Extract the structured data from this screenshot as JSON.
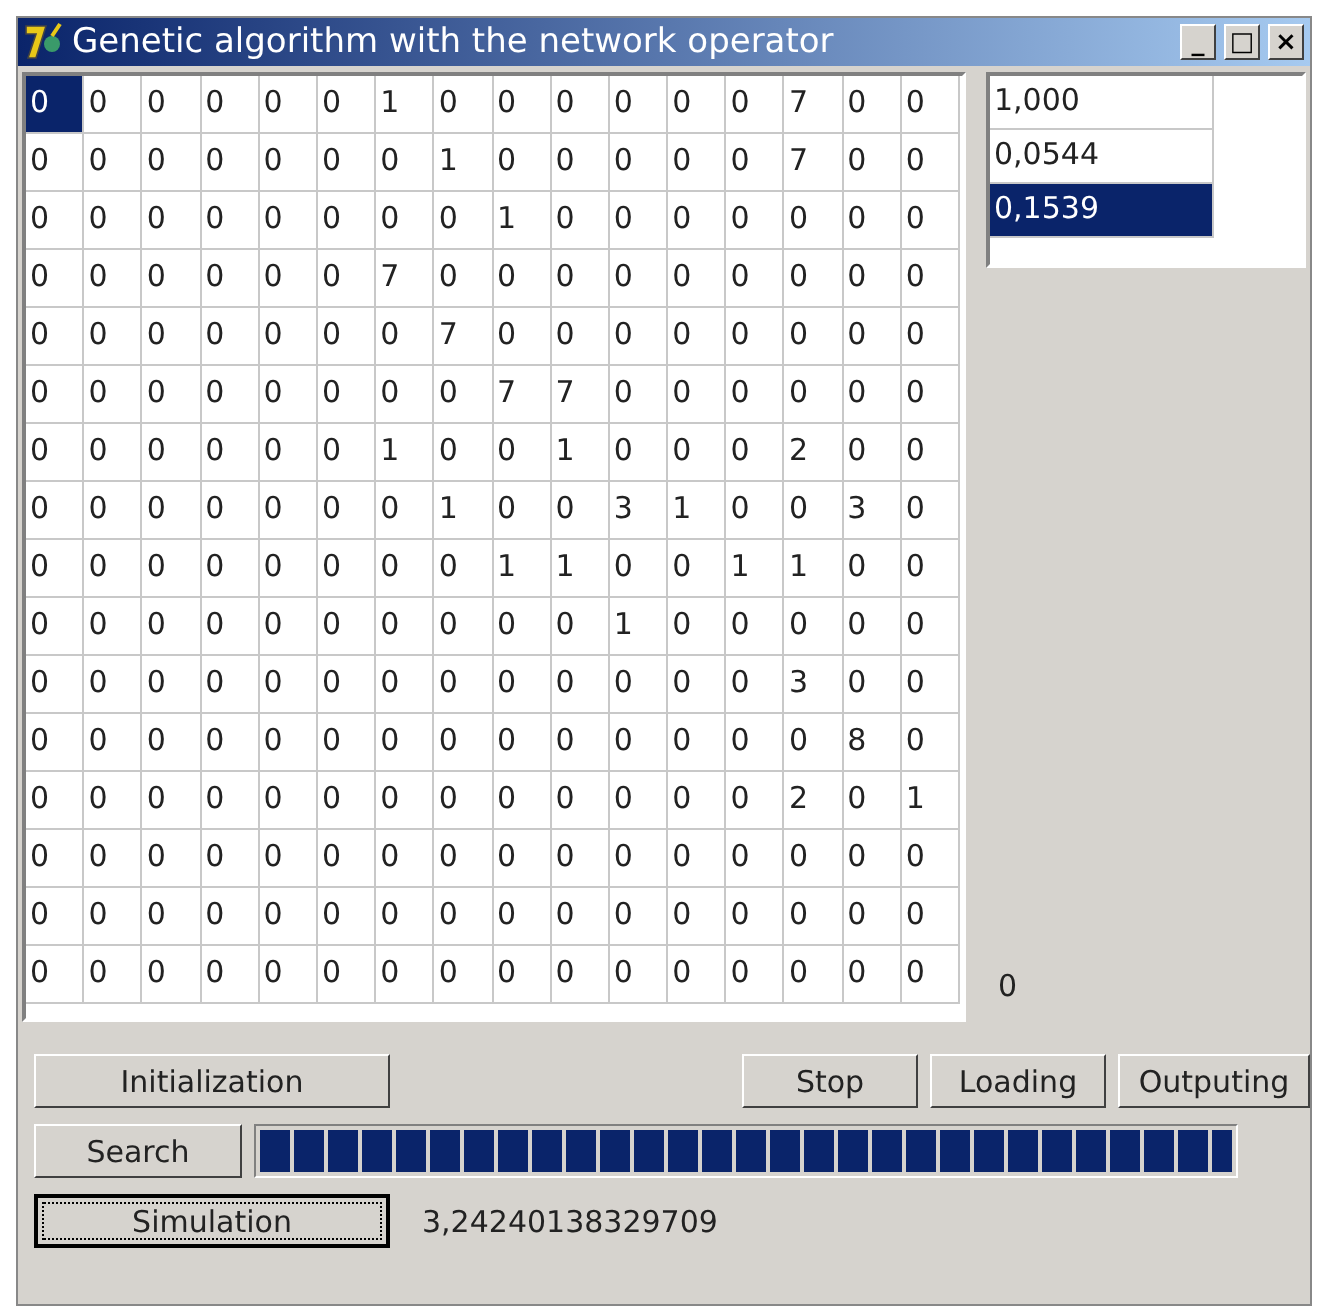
{
  "window": {
    "title": "Genetic algorithm with the network operator",
    "controls": [
      "_",
      "□",
      "×"
    ]
  },
  "matrix": {
    "rows": [
      [
        {
          "text": "0",
          "selected": true
        },
        {
          "text": "0",
          "selected": false
        },
        {
          "text": "0",
          "selected": false
        },
        {
          "text": "0",
          "selected": false
        },
        {
          "text": "0",
          "selected": false
        },
        {
          "text": "0",
          "selected": false
        },
        {
          "text": "1",
          "selected": false
        },
        {
          "text": "0",
          "selected": false
        },
        {
          "text": "0",
          "selected": false
        },
        {
          "text": "0",
          "selected": false
        },
        {
          "text": "0",
          "selected": false
        },
        {
          "text": "0",
          "selected": false
        },
        {
          "text": "0",
          "selected": false
        },
        {
          "text": "7",
          "selected": false
        },
        {
          "text": "0",
          "selected": false
        },
        {
          "text": "0",
          "selected": false
        }
      ],
      [
        {
          "text": "0",
          "selected": false
        },
        {
          "text": "0",
          "selected": false
        },
        {
          "text": "0",
          "selected": false
        },
        {
          "text": "0",
          "selected": false
        },
        {
          "text": "0",
          "selected": false
        },
        {
          "text": "0",
          "selected": false
        },
        {
          "text": "0",
          "selected": false
        },
        {
          "text": "1",
          "selected": false
        },
        {
          "text": "0",
          "selected": false
        },
        {
          "text": "0",
          "selected": false
        },
        {
          "text": "0",
          "selected": false
        },
        {
          "text": "0",
          "selected": false
        },
        {
          "text": "0",
          "selected": false
        },
        {
          "text": "7",
          "selected": false
        },
        {
          "text": "0",
          "selected": false
        },
        {
          "text": "0",
          "selected": false
        }
      ],
      [
        {
          "text": "0",
          "selected": false
        },
        {
          "text": "0",
          "selected": false
        },
        {
          "text": "0",
          "selected": false
        },
        {
          "text": "0",
          "selected": false
        },
        {
          "text": "0",
          "selected": false
        },
        {
          "text": "0",
          "selected": false
        },
        {
          "text": "0",
          "selected": false
        },
        {
          "text": "0",
          "selected": false
        },
        {
          "text": "1",
          "selected": false
        },
        {
          "text": "0",
          "selected": false
        },
        {
          "text": "0",
          "selected": false
        },
        {
          "text": "0",
          "selected": false
        },
        {
          "text": "0",
          "selected": false
        },
        {
          "text": "0",
          "selected": false
        },
        {
          "text": "0",
          "selected": false
        },
        {
          "text": "0",
          "selected": false
        }
      ],
      [
        {
          "text": "0",
          "selected": false
        },
        {
          "text": "0",
          "selected": false
        },
        {
          "text": "0",
          "selected": false
        },
        {
          "text": "0",
          "selected": false
        },
        {
          "text": "0",
          "selected": false
        },
        {
          "text": "0",
          "selected": false
        },
        {
          "text": "7",
          "selected": false
        },
        {
          "text": "0",
          "selected": false
        },
        {
          "text": "0",
          "selected": false
        },
        {
          "text": "0",
          "selected": false
        },
        {
          "text": "0",
          "selected": false
        },
        {
          "text": "0",
          "selected": false
        },
        {
          "text": "0",
          "selected": false
        },
        {
          "text": "0",
          "selected": false
        },
        {
          "text": "0",
          "selected": false
        },
        {
          "text": "0",
          "selected": false
        }
      ],
      [
        {
          "text": "0",
          "selected": false
        },
        {
          "text": "0",
          "selected": false
        },
        {
          "text": "0",
          "selected": false
        },
        {
          "text": "0",
          "selected": false
        },
        {
          "text": "0",
          "selected": false
        },
        {
          "text": "0",
          "selected": false
        },
        {
          "text": "0",
          "selected": false
        },
        {
          "text": "7",
          "selected": false
        },
        {
          "text": "0",
          "selected": false
        },
        {
          "text": "0",
          "selected": false
        },
        {
          "text": "0",
          "selected": false
        },
        {
          "text": "0",
          "selected": false
        },
        {
          "text": "0",
          "selected": false
        },
        {
          "text": "0",
          "selected": false
        },
        {
          "text": "0",
          "selected": false
        },
        {
          "text": "0",
          "selected": false
        }
      ],
      [
        {
          "text": "0",
          "selected": false
        },
        {
          "text": "0",
          "selected": false
        },
        {
          "text": "0",
          "selected": false
        },
        {
          "text": "0",
          "selected": false
        },
        {
          "text": "0",
          "selected": false
        },
        {
          "text": "0",
          "selected": false
        },
        {
          "text": "0",
          "selected": false
        },
        {
          "text": "0",
          "selected": false
        },
        {
          "text": "7",
          "selected": false
        },
        {
          "text": "7",
          "selected": false
        },
        {
          "text": "0",
          "selected": false
        },
        {
          "text": "0",
          "selected": false
        },
        {
          "text": "0",
          "selected": false
        },
        {
          "text": "0",
          "selected": false
        },
        {
          "text": "0",
          "selected": false
        },
        {
          "text": "0",
          "selected": false
        }
      ],
      [
        {
          "text": "0",
          "selected": false
        },
        {
          "text": "0",
          "selected": false
        },
        {
          "text": "0",
          "selected": false
        },
        {
          "text": "0",
          "selected": false
        },
        {
          "text": "0",
          "selected": false
        },
        {
          "text": "0",
          "selected": false
        },
        {
          "text": "1",
          "selected": false
        },
        {
          "text": "0",
          "selected": false
        },
        {
          "text": "0",
          "selected": false
        },
        {
          "text": "1",
          "selected": false
        },
        {
          "text": "0",
          "selected": false
        },
        {
          "text": "0",
          "selected": false
        },
        {
          "text": "0",
          "selected": false
        },
        {
          "text": "2",
          "selected": false
        },
        {
          "text": "0",
          "selected": false
        },
        {
          "text": "0",
          "selected": false
        }
      ],
      [
        {
          "text": "0",
          "selected": false
        },
        {
          "text": "0",
          "selected": false
        },
        {
          "text": "0",
          "selected": false
        },
        {
          "text": "0",
          "selected": false
        },
        {
          "text": "0",
          "selected": false
        },
        {
          "text": "0",
          "selected": false
        },
        {
          "text": "0",
          "selected": false
        },
        {
          "text": "1",
          "selected": false
        },
        {
          "text": "0",
          "selected": false
        },
        {
          "text": "0",
          "selected": false
        },
        {
          "text": "3",
          "selected": false
        },
        {
          "text": "1",
          "selected": false
        },
        {
          "text": "0",
          "selected": false
        },
        {
          "text": "0",
          "selected": false
        },
        {
          "text": "3",
          "selected": false
        },
        {
          "text": "0",
          "selected": false
        }
      ],
      [
        {
          "text": "0",
          "selected": false
        },
        {
          "text": "0",
          "selected": false
        },
        {
          "text": "0",
          "selected": false
        },
        {
          "text": "0",
          "selected": false
        },
        {
          "text": "0",
          "selected": false
        },
        {
          "text": "0",
          "selected": false
        },
        {
          "text": "0",
          "selected": false
        },
        {
          "text": "0",
          "selected": false
        },
        {
          "text": "1",
          "selected": false
        },
        {
          "text": "1",
          "selected": false
        },
        {
          "text": "0",
          "selected": false
        },
        {
          "text": "0",
          "selected": false
        },
        {
          "text": "1",
          "selected": false
        },
        {
          "text": "1",
          "selected": false
        },
        {
          "text": "0",
          "selected": false
        },
        {
          "text": "0",
          "selected": false
        }
      ],
      [
        {
          "text": "0",
          "selected": false
        },
        {
          "text": "0",
          "selected": false
        },
        {
          "text": "0",
          "selected": false
        },
        {
          "text": "0",
          "selected": false
        },
        {
          "text": "0",
          "selected": false
        },
        {
          "text": "0",
          "selected": false
        },
        {
          "text": "0",
          "selected": false
        },
        {
          "text": "0",
          "selected": false
        },
        {
          "text": "0",
          "selected": false
        },
        {
          "text": "0",
          "selected": false
        },
        {
          "text": "1",
          "selected": false
        },
        {
          "text": "0",
          "selected": false
        },
        {
          "text": "0",
          "selected": false
        },
        {
          "text": "0",
          "selected": false
        },
        {
          "text": "0",
          "selected": false
        },
        {
          "text": "0",
          "selected": false
        }
      ],
      [
        {
          "text": "0",
          "selected": false
        },
        {
          "text": "0",
          "selected": false
        },
        {
          "text": "0",
          "selected": false
        },
        {
          "text": "0",
          "selected": false
        },
        {
          "text": "0",
          "selected": false
        },
        {
          "text": "0",
          "selected": false
        },
        {
          "text": "0",
          "selected": false
        },
        {
          "text": "0",
          "selected": false
        },
        {
          "text": "0",
          "selected": false
        },
        {
          "text": "0",
          "selected": false
        },
        {
          "text": "0",
          "selected": false
        },
        {
          "text": "0",
          "selected": false
        },
        {
          "text": "0",
          "selected": false
        },
        {
          "text": "3",
          "selected": false
        },
        {
          "text": "0",
          "selected": false
        },
        {
          "text": "0",
          "selected": false
        }
      ],
      [
        {
          "text": "0",
          "selected": false
        },
        {
          "text": "0",
          "selected": false
        },
        {
          "text": "0",
          "selected": false
        },
        {
          "text": "0",
          "selected": false
        },
        {
          "text": "0",
          "selected": false
        },
        {
          "text": "0",
          "selected": false
        },
        {
          "text": "0",
          "selected": false
        },
        {
          "text": "0",
          "selected": false
        },
        {
          "text": "0",
          "selected": false
        },
        {
          "text": "0",
          "selected": false
        },
        {
          "text": "0",
          "selected": false
        },
        {
          "text": "0",
          "selected": false
        },
        {
          "text": "0",
          "selected": false
        },
        {
          "text": "0",
          "selected": false
        },
        {
          "text": "8",
          "selected": false
        },
        {
          "text": "0",
          "selected": false
        }
      ],
      [
        {
          "text": "0",
          "selected": false
        },
        {
          "text": "0",
          "selected": false
        },
        {
          "text": "0",
          "selected": false
        },
        {
          "text": "0",
          "selected": false
        },
        {
          "text": "0",
          "selected": false
        },
        {
          "text": "0",
          "selected": false
        },
        {
          "text": "0",
          "selected": false
        },
        {
          "text": "0",
          "selected": false
        },
        {
          "text": "0",
          "selected": false
        },
        {
          "text": "0",
          "selected": false
        },
        {
          "text": "0",
          "selected": false
        },
        {
          "text": "0",
          "selected": false
        },
        {
          "text": "0",
          "selected": false
        },
        {
          "text": "2",
          "selected": false
        },
        {
          "text": "0",
          "selected": false
        },
        {
          "text": "1",
          "selected": false
        }
      ],
      [
        {
          "text": "0",
          "selected": false
        },
        {
          "text": "0",
          "selected": false
        },
        {
          "text": "0",
          "selected": false
        },
        {
          "text": "0",
          "selected": false
        },
        {
          "text": "0",
          "selected": false
        },
        {
          "text": "0",
          "selected": false
        },
        {
          "text": "0",
          "selected": false
        },
        {
          "text": "0",
          "selected": false
        },
        {
          "text": "0",
          "selected": false
        },
        {
          "text": "0",
          "selected": false
        },
        {
          "text": "0",
          "selected": false
        },
        {
          "text": "0",
          "selected": false
        },
        {
          "text": "0",
          "selected": false
        },
        {
          "text": "0",
          "selected": false
        },
        {
          "text": "0",
          "selected": false
        },
        {
          "text": "0",
          "selected": false
        }
      ],
      [
        {
          "text": "0",
          "selected": false
        },
        {
          "text": "0",
          "selected": false
        },
        {
          "text": "0",
          "selected": false
        },
        {
          "text": "0",
          "selected": false
        },
        {
          "text": "0",
          "selected": false
        },
        {
          "text": "0",
          "selected": false
        },
        {
          "text": "0",
          "selected": false
        },
        {
          "text": "0",
          "selected": false
        },
        {
          "text": "0",
          "selected": false
        },
        {
          "text": "0",
          "selected": false
        },
        {
          "text": "0",
          "selected": false
        },
        {
          "text": "0",
          "selected": false
        },
        {
          "text": "0",
          "selected": false
        },
        {
          "text": "0",
          "selected": false
        },
        {
          "text": "0",
          "selected": false
        },
        {
          "text": "0",
          "selected": false
        }
      ],
      [
        {
          "text": "0",
          "selected": false
        },
        {
          "text": "0",
          "selected": false
        },
        {
          "text": "0",
          "selected": false
        },
        {
          "text": "0",
          "selected": false
        },
        {
          "text": "0",
          "selected": false
        },
        {
          "text": "0",
          "selected": false
        },
        {
          "text": "0",
          "selected": false
        },
        {
          "text": "0",
          "selected": false
        },
        {
          "text": "0",
          "selected": false
        },
        {
          "text": "0",
          "selected": false
        },
        {
          "text": "0",
          "selected": false
        },
        {
          "text": "0",
          "selected": false
        },
        {
          "text": "0",
          "selected": false
        },
        {
          "text": "0",
          "selected": false
        },
        {
          "text": "0",
          "selected": false
        },
        {
          "text": "0",
          "selected": false
        }
      ]
    ]
  },
  "values_list": [
    {
      "text": "1,000",
      "selected": false
    },
    {
      "text": "0,0544",
      "selected": false
    },
    {
      "text": "0,1539",
      "selected": true
    }
  ],
  "count_label": "0",
  "buttons_top": [
    {
      "label": "Initialization",
      "focused": false
    },
    {
      "label": "Stop",
      "focused": false
    },
    {
      "label": "Loading",
      "focused": false
    },
    {
      "label": "Outputing",
      "focused": false
    }
  ],
  "search_button": {
    "label": "Search",
    "focused": false
  },
  "progress": {
    "level": 1
  },
  "simulation_button": {
    "label": "Simulation",
    "focused": true
  },
  "result": "3,24240138329709"
}
